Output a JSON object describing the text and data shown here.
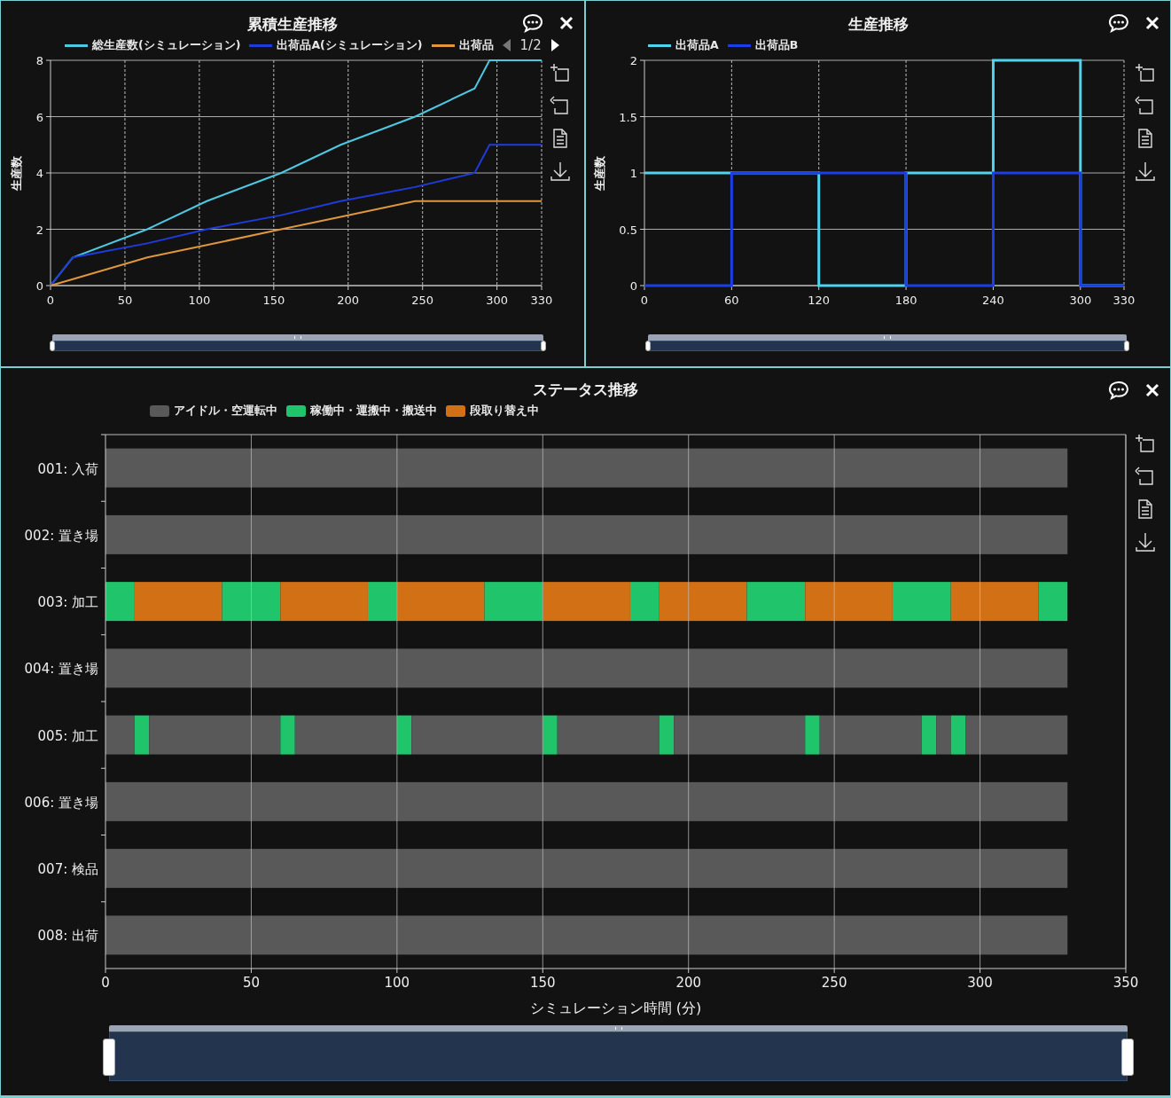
{
  "panels": [
    {
      "title": "累積生産推移",
      "legend_pager": {
        "text": "1/2",
        "prev_disabled": true,
        "next_disabled": false
      },
      "slider": {
        "level": 1
      },
      "chart_data": {
        "type": "line",
        "grid": true,
        "ylabel": "生産数",
        "x": [
          0,
          15,
          65,
          105,
          155,
          195,
          245,
          285,
          295,
          330
        ],
        "series": [
          {
            "name": "総生産数(シミュレーション)",
            "color": "#4ec8e0",
            "values": [
              0,
              1,
              2,
              3,
              4,
              5,
              6,
              7,
              8,
              8
            ]
          },
          {
            "name": "出荷品A(シミュレーション)",
            "color": "#1e3cdc",
            "values": [
              0,
              1,
              1.5,
              2,
              2.5,
              3,
              3.5,
              4,
              5,
              5
            ]
          },
          {
            "name": "出荷品",
            "color": "#e0963c",
            "values": [
              0,
              0.23,
              1,
              1.44,
              2,
              2.44,
              3,
              3,
              3,
              3
            ]
          }
        ],
        "xlim": [
          0,
          330
        ],
        "ylim": [
          0,
          8
        ],
        "xticks": [
          0,
          50,
          100,
          150,
          200,
          250,
          300,
          330
        ],
        "yticks": [
          0,
          2,
          4,
          6,
          8
        ]
      }
    },
    {
      "title": "生産推移",
      "slider": {
        "level": 1
      },
      "chart_data": {
        "type": "line",
        "grid": true,
        "ylabel": "生産数",
        "x": [
          0,
          60,
          60,
          120,
          120,
          180,
          180,
          240,
          240,
          300,
          300,
          330
        ],
        "series": [
          {
            "name": "出荷品A",
            "color": "#4dd4ee",
            "values": [
              1,
              1,
              1,
              1,
              0,
              0,
              1,
              1,
              2,
              2,
              0,
              0
            ]
          },
          {
            "name": "出荷品B",
            "color": "#1c3ee8",
            "values": [
              0,
              0,
              1,
              1,
              1,
              1,
              0,
              0,
              1,
              1,
              0,
              0
            ]
          }
        ],
        "xlim": [
          0,
          330
        ],
        "ylim": [
          0,
          2
        ],
        "xticks": [
          0,
          60,
          120,
          180,
          240,
          300,
          330
        ],
        "yticks": [
          0,
          {
            "value": 0.5,
            "label": "0.5"
          },
          1,
          {
            "value": 1.5,
            "label": "1.5"
          },
          2
        ]
      }
    }
  ],
  "status": {
    "title": "ステータス推移",
    "slider": {
      "level": 1
    },
    "legend": [
      {
        "label": "アイドル・空運転中",
        "color": "#595959"
      },
      {
        "label": "稼働中・運搬中・搬送中",
        "color": "#1fc46b"
      },
      {
        "label": "段取り替え中",
        "color": "#d27016"
      }
    ],
    "chart_data": {
      "type": "bar",
      "orientation": "horizontal",
      "stacked": true,
      "grid": true,
      "xlabel": "シミュレーション時間 (分)",
      "categories": [
        "001: 入荷",
        "002: 置き場",
        "003: 加工",
        "004: 置き場",
        "005: 加工",
        "006: 置き場",
        "007: 検品",
        "008: 出荷"
      ],
      "series": [
        {
          "color": "#595959",
          "values": [
            330,
            330,
            null,
            330,
            10,
            330,
            330,
            330
          ]
        },
        {
          "color": "#1fc46b",
          "values": [
            null,
            null,
            10,
            null,
            5,
            null,
            null,
            null
          ]
        },
        {
          "color": "#d27016",
          "values": [
            null,
            null,
            30,
            null,
            null,
            null,
            null,
            null
          ]
        },
        {
          "color": "#595959",
          "values": [
            null,
            null,
            null,
            null,
            45,
            null,
            null,
            null
          ]
        },
        {
          "color": "#1fc46b",
          "values": [
            null,
            null,
            20,
            null,
            5,
            null,
            null,
            null
          ]
        },
        {
          "color": "#d27016",
          "values": [
            null,
            null,
            30,
            null,
            null,
            null,
            null,
            null
          ]
        },
        {
          "color": "#595959",
          "values": [
            null,
            null,
            null,
            null,
            35,
            null,
            null,
            null
          ]
        },
        {
          "color": "#1fc46b",
          "values": [
            null,
            null,
            10,
            null,
            5,
            null,
            null,
            null
          ]
        },
        {
          "color": "#d27016",
          "values": [
            null,
            null,
            30,
            null,
            null,
            null,
            null,
            null
          ]
        },
        {
          "color": "#595959",
          "values": [
            null,
            null,
            null,
            null,
            45,
            null,
            null,
            null
          ]
        },
        {
          "color": "#1fc46b",
          "values": [
            null,
            null,
            20,
            null,
            5,
            null,
            null,
            null
          ]
        },
        {
          "color": "#d27016",
          "values": [
            null,
            null,
            30,
            null,
            null,
            null,
            null,
            null
          ]
        },
        {
          "color": "#595959",
          "values": [
            null,
            null,
            null,
            null,
            35,
            null,
            null,
            null
          ]
        },
        {
          "color": "#1fc46b",
          "values": [
            null,
            null,
            10,
            null,
            5,
            null,
            null,
            null
          ]
        },
        {
          "color": "#d27016",
          "values": [
            null,
            null,
            30,
            null,
            null,
            null,
            null,
            null
          ]
        },
        {
          "color": "#595959",
          "values": [
            null,
            null,
            null,
            null,
            45,
            null,
            null,
            null
          ]
        },
        {
          "color": "#1fc46b",
          "values": [
            null,
            null,
            20,
            null,
            5,
            null,
            null,
            null
          ]
        },
        {
          "color": "#d27016",
          "values": [
            null,
            null,
            30,
            null,
            null,
            null,
            null,
            null
          ]
        },
        {
          "color": "#595959",
          "values": [
            null,
            null,
            null,
            null,
            35,
            null,
            null,
            null
          ]
        },
        {
          "color": "#1fc46b",
          "values": [
            null,
            null,
            20,
            null,
            5,
            null,
            null,
            null
          ]
        },
        {
          "color": "#d27016",
          "values": [
            null,
            null,
            30,
            null,
            null,
            null,
            null,
            null
          ]
        },
        {
          "color": "#595959",
          "values": [
            null,
            null,
            null,
            null,
            5,
            null,
            null,
            null
          ]
        },
        {
          "color": "#1fc46b",
          "values": [
            null,
            null,
            10,
            null,
            5,
            null,
            null,
            null
          ]
        },
        {
          "color": "#595959",
          "values": [
            null,
            null,
            null,
            null,
            35,
            null,
            null,
            null
          ]
        }
      ],
      "xlim": [
        0,
        350
      ],
      "xticks": [
        0,
        50,
        100,
        150,
        200,
        250,
        300,
        350
      ]
    }
  }
}
